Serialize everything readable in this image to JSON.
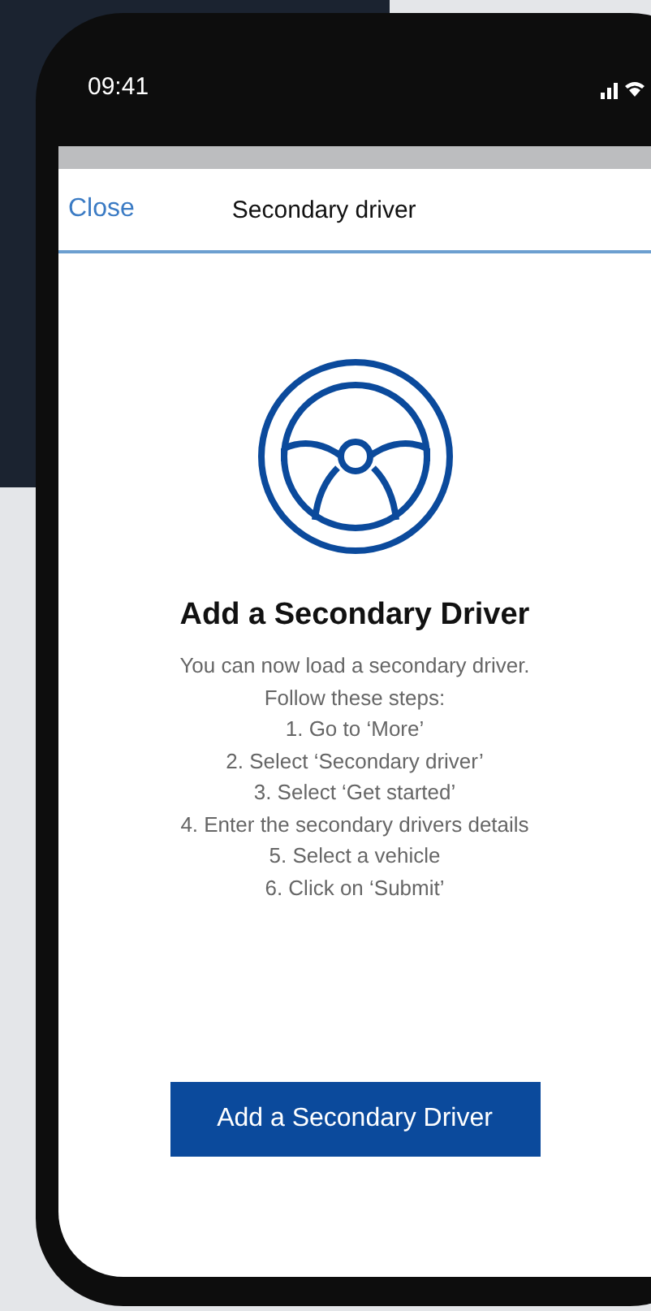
{
  "status_bar": {
    "time": "09:41"
  },
  "nav": {
    "close": "Close",
    "title": "Secondary driver"
  },
  "content": {
    "heading": "Add a Secondary Driver",
    "lines": [
      "You can now load a secondary driver.",
      "Follow these steps:",
      "1. Go to ‘More’",
      "2. Select ‘Secondary driver’",
      "3. Select ‘Get started’",
      "4. Enter the secondary drivers details",
      "5. Select a vehicle",
      "6. Click on ‘Submit’"
    ]
  },
  "button": "Add a Secondary Driver"
}
